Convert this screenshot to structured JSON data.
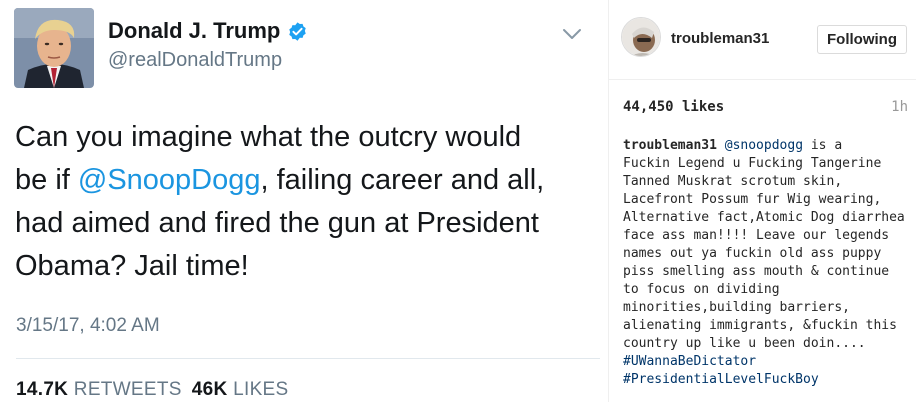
{
  "tweet": {
    "name": "Donald J. Trump",
    "handle": "@realDonaldTrump",
    "text_lines": [
      {
        "pre": "Can you imagine what the outcry would",
        "mention": "",
        "post": ""
      },
      {
        "pre": "be if ",
        "mention": "@SnoopDogg",
        "post": ", failing career and all,"
      },
      {
        "pre": "had aimed and fired the gun at President",
        "mention": "",
        "post": ""
      },
      {
        "pre": "Obama? Jail time!",
        "mention": "",
        "post": ""
      }
    ],
    "timestamp": "3/15/17, 4:02 AM",
    "retweets_count": "14.7K",
    "retweets_label": "RETWEETS",
    "likes_count": "46K",
    "likes_label": "LIKES",
    "verified_icon": "verified-badge-icon",
    "menu_icon": "chevron-down-icon",
    "colors": {
      "mention": "#1b95e0",
      "text": "#14171a",
      "muted": "#657786",
      "verified": "#1da1f2"
    }
  },
  "instagram": {
    "username": "troubleman31",
    "follow_button": "Following",
    "likes": "44,450 likes",
    "time_ago": "1h",
    "caption_lines": [
      {
        "user": "troubleman31",
        "text": " ",
        "link": "@snoopdogg",
        "rest": " is a"
      },
      {
        "user": "",
        "text": "Fuckin Legend u Fucking Tangerine",
        "link": "",
        "rest": ""
      },
      {
        "user": "",
        "text": "Tanned Muskrat scrotum skin,",
        "link": "",
        "rest": ""
      },
      {
        "user": "",
        "text": "Lacefront Possum fur Wig wearing,",
        "link": "",
        "rest": ""
      },
      {
        "user": "",
        "text": "Alternative fact,Atomic Dog diarrhea",
        "link": "",
        "rest": ""
      },
      {
        "user": "",
        "text": "face ass man!!!! Leave our legends",
        "link": "",
        "rest": ""
      },
      {
        "user": "",
        "text": "names out ya fuckin old ass puppy",
        "link": "",
        "rest": ""
      },
      {
        "user": "",
        "text": "piss smelling ass mouth & continue",
        "link": "",
        "rest": ""
      },
      {
        "user": "",
        "text": "to focus on dividing",
        "link": "",
        "rest": ""
      },
      {
        "user": "",
        "text": "minorities,building barriers,",
        "link": "",
        "rest": ""
      },
      {
        "user": "",
        "text": "alienating immigrants, &fuckin this",
        "link": "",
        "rest": ""
      },
      {
        "user": "",
        "text": "country up like u been doin....",
        "link": "",
        "rest": ""
      },
      {
        "user": "",
        "text": "",
        "link": "#UWannaBeDictator",
        "rest": ""
      },
      {
        "user": "",
        "text": "",
        "link": "#PresidentialLevelFuckBoy",
        "rest": ""
      }
    ],
    "colors": {
      "link": "#003569",
      "text": "#262626",
      "muted": "#999999"
    }
  }
}
